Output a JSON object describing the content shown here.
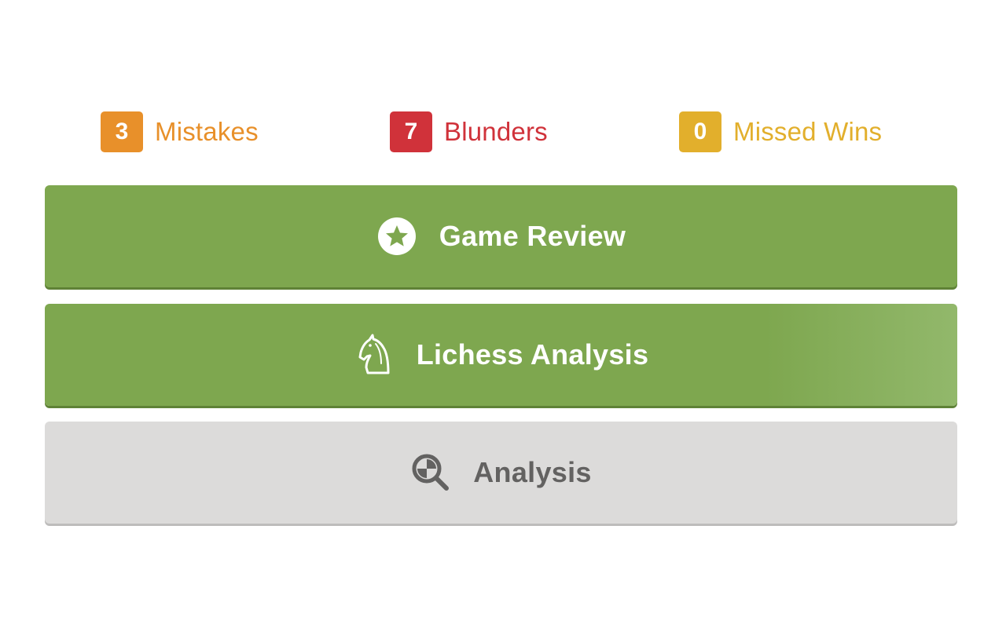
{
  "stats": {
    "mistakes": {
      "count": "3",
      "label": "Mistakes",
      "color": "#e8902a"
    },
    "blunders": {
      "count": "7",
      "label": "Blunders",
      "color": "#d0323a"
    },
    "missed_wins": {
      "count": "0",
      "label": "Missed Wins",
      "color": "#e2af2c"
    }
  },
  "buttons": {
    "game_review": {
      "label": "Game Review",
      "icon": "star-circle-icon",
      "color": "#7ea74f"
    },
    "lichess_analysis": {
      "label": "Lichess Analysis",
      "icon": "knight-icon",
      "color": "#7ea74f"
    },
    "analysis": {
      "label": "Analysis",
      "icon": "magnifier-icon",
      "color": "#dcdbda"
    }
  }
}
